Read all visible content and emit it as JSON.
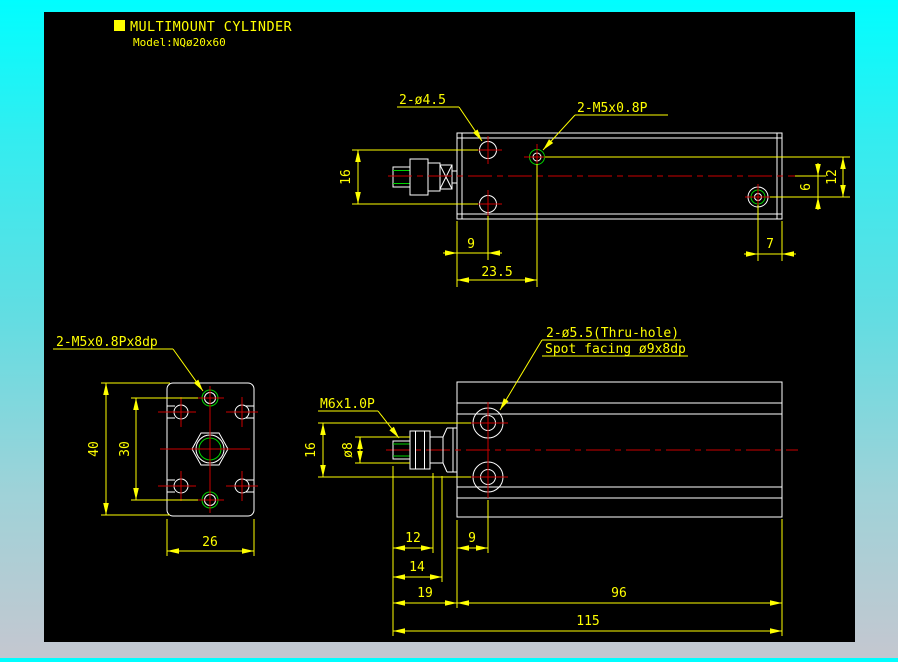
{
  "colors": {
    "background_top": "#00feff",
    "background_bottom": "#c4c7d0",
    "canvas": "#000000",
    "line_white": "#ffffff",
    "line_yellow": "#ffff00",
    "line_red": "#cc0000",
    "line_green": "#00d400"
  },
  "header": {
    "title": "MULTIMOUNT CYLINDER",
    "model": "Model:NQø20x60"
  },
  "top_view": {
    "label_mount_holes": "2-ø4.5",
    "label_ports": "2-M5x0.8P",
    "dim_hole_spacing": "16",
    "dim_port_center": "6",
    "dim_port_spacing": "12",
    "dim_hole_offset": "9",
    "dim_port_offset": "23.5",
    "dim_port_right_offset": "7"
  },
  "front_view": {
    "label_tapped_holes": "2-M5x0.8Px8dp",
    "dim_height": "40",
    "dim_tap_spacing": "30",
    "dim_width": "26"
  },
  "side_view": {
    "label_rod_thread": "M6x1.0P",
    "label_thru_hole_line1": "2-ø5.5(Thru-hole)",
    "label_thru_hole_line2": "Spot facing ø9x8dp",
    "dim_thru_spacing": "16",
    "dim_rod_dia": "ø8",
    "dim_thread_len": "12",
    "dim_thru_edge": "9",
    "dim_rod_step": "14",
    "dim_rod_total": "19",
    "dim_body_len": "96",
    "dim_total_len": "115"
  }
}
